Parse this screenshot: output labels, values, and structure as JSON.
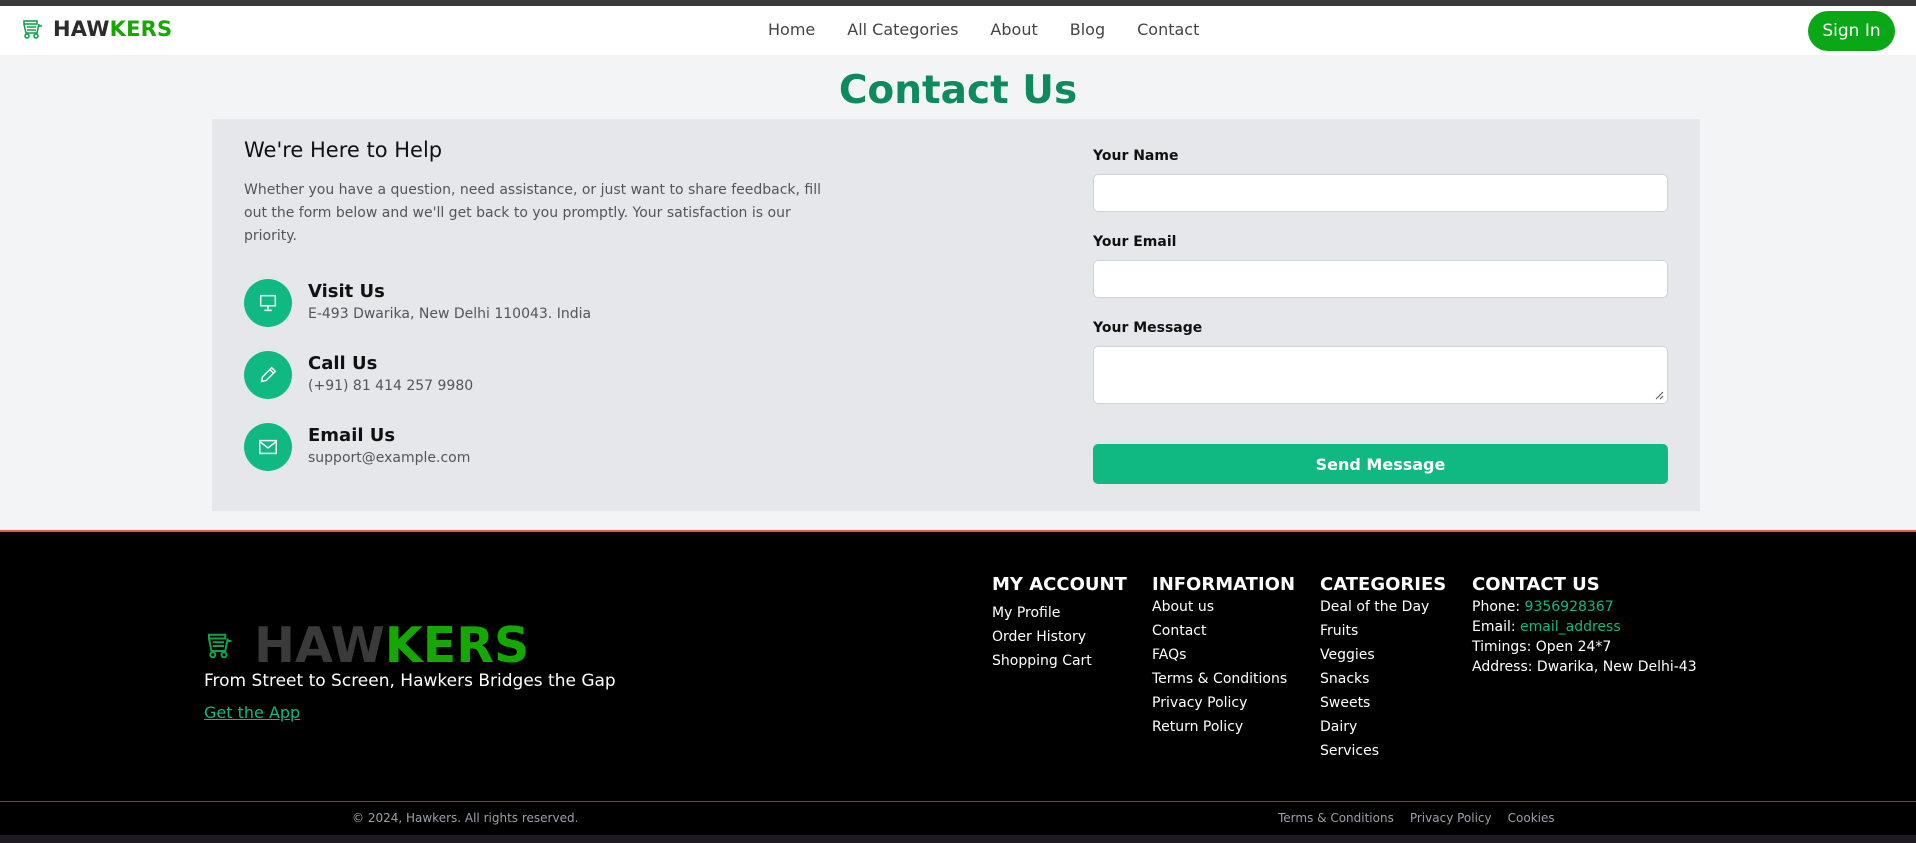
{
  "header": {
    "brand_a": "HAW",
    "brand_b": "KERS",
    "nav": [
      "Home",
      "All Categories",
      "About",
      "Blog",
      "Contact"
    ],
    "signin": "Sign In"
  },
  "page_title": "Contact Us",
  "help": {
    "title": "We're Here to Help",
    "text": "Whether you have a question, need assistance, or just want to share feedback, fill out the form below and we'll get back to you promptly. Your satisfaction is our priority."
  },
  "contacts": [
    {
      "title": "Visit Us",
      "detail": "E-493 Dwarika, New Delhi 110043. India",
      "icon": "presentation-icon"
    },
    {
      "title": "Call Us",
      "detail": "(+91) 81 414 257 9980",
      "icon": "pencil-icon"
    },
    {
      "title": "Email Us",
      "detail": "support@example.com",
      "icon": "mail-icon"
    }
  ],
  "form": {
    "name_label": "Your Name",
    "email_label": "Your Email",
    "message_label": "Your Message",
    "send": "Send Message"
  },
  "footer": {
    "brand_a": "HAW",
    "brand_b": "KERS",
    "tagline": "From Street to Screen, Hawkers Bridges the Gap",
    "getapp": "Get the App",
    "account": {
      "title": "MY ACCOUNT",
      "items": [
        "My Profile",
        "Order History",
        "Shopping Cart"
      ]
    },
    "information": {
      "title": "INFORMATION",
      "items": [
        "About us",
        "Contact",
        "FAQs",
        "Terms & Conditions",
        "Privacy Policy",
        "Return Policy"
      ]
    },
    "categories": {
      "title": "CATEGORIES",
      "items": [
        "Deal of the Day",
        "Fruits",
        "Veggies",
        "Snacks",
        "Sweets",
        "Dairy",
        "Services"
      ]
    },
    "contact": {
      "title": "CONTACT US",
      "phone_label": "Phone: ",
      "phone": "9356928367",
      "email_label": "Email: ",
      "email": "email_address",
      "timings": "Timings: Open 24*7",
      "address": "Address: Dwarika, New Delhi-43"
    }
  },
  "bottom": {
    "copyright": "© 2024, Hawkers. All rights reserved.",
    "links": [
      "Terms & Conditions",
      "Privacy Policy",
      "Cookies"
    ]
  },
  "colors": {
    "brand_green": "#14a800",
    "accent_teal": "#10b981",
    "title_green": "#0f8a5f"
  }
}
